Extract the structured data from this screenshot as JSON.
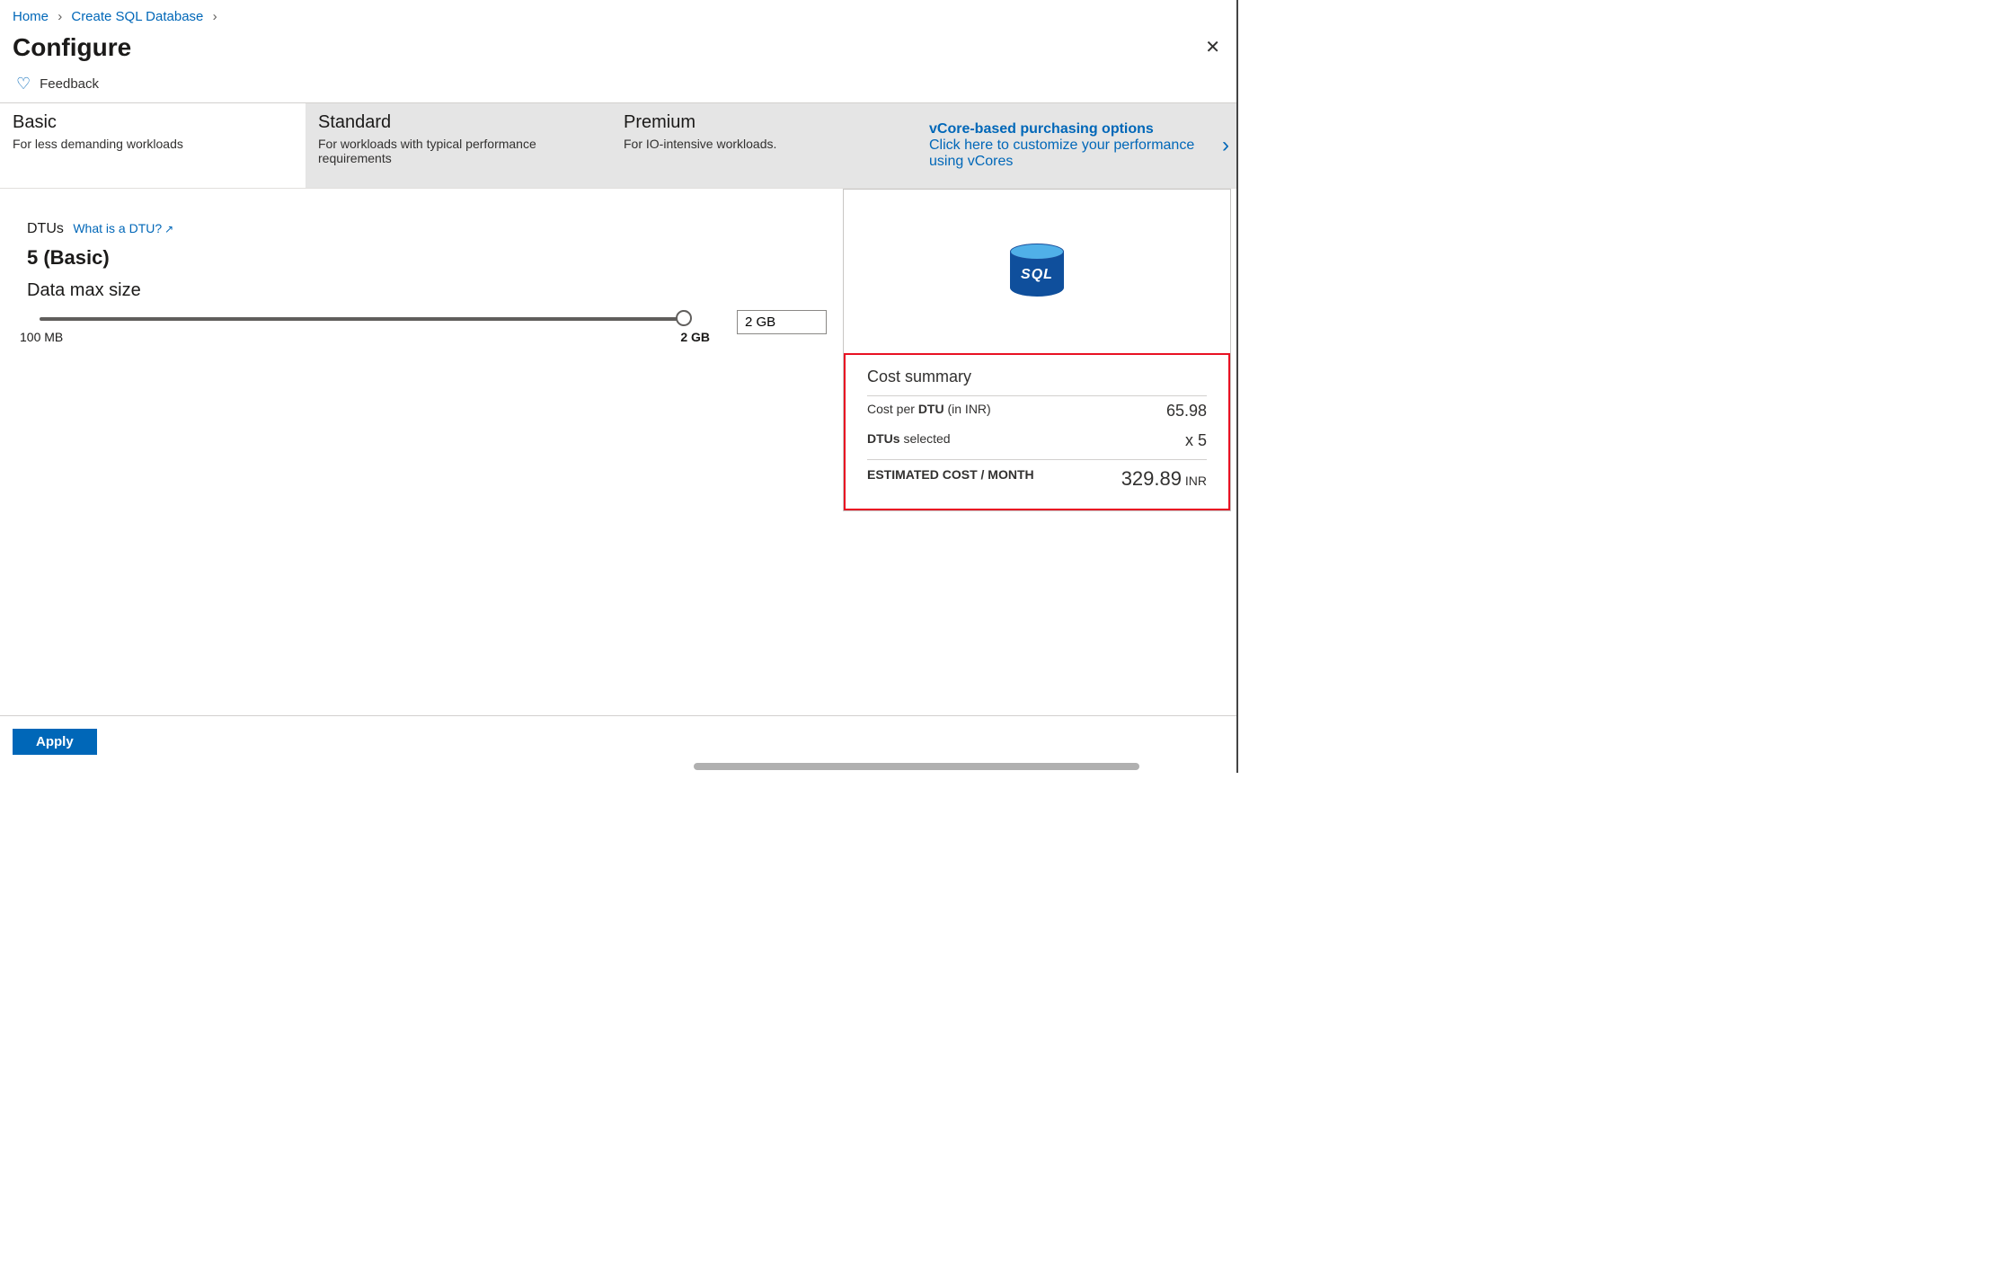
{
  "breadcrumb": {
    "home": "Home",
    "create": "Create SQL Database"
  },
  "page": {
    "title": "Configure",
    "feedback": "Feedback"
  },
  "tiers": {
    "basic": {
      "title": "Basic",
      "desc": "For less demanding workloads"
    },
    "standard": {
      "title": "Standard",
      "desc": "For workloads with typical performance requirements"
    },
    "premium": {
      "title": "Premium",
      "desc": "For IO-intensive workloads."
    },
    "vcore": {
      "title": "vCore-based purchasing options",
      "desc": "Click here to customize your performance using vCores"
    }
  },
  "dtu": {
    "label": "DTUs",
    "what_link": "What is a DTU?",
    "value": "5 (Basic)"
  },
  "size": {
    "label": "Data max size",
    "min": "100 MB",
    "max": "2 GB",
    "input": "2 GB"
  },
  "sql_icon_label": "SQL",
  "cost": {
    "title": "Cost summary",
    "per_dtu_label_pre": "Cost per ",
    "per_dtu_label_bold": "DTU",
    "per_dtu_label_post": " (in INR)",
    "per_dtu_value": "65.98",
    "selected_label_bold": "DTUs",
    "selected_label_post": " selected",
    "selected_value": "x 5",
    "est_label": "ESTIMATED COST / MONTH",
    "est_value": "329.89",
    "est_currency": "INR"
  },
  "buttons": {
    "apply": "Apply"
  }
}
